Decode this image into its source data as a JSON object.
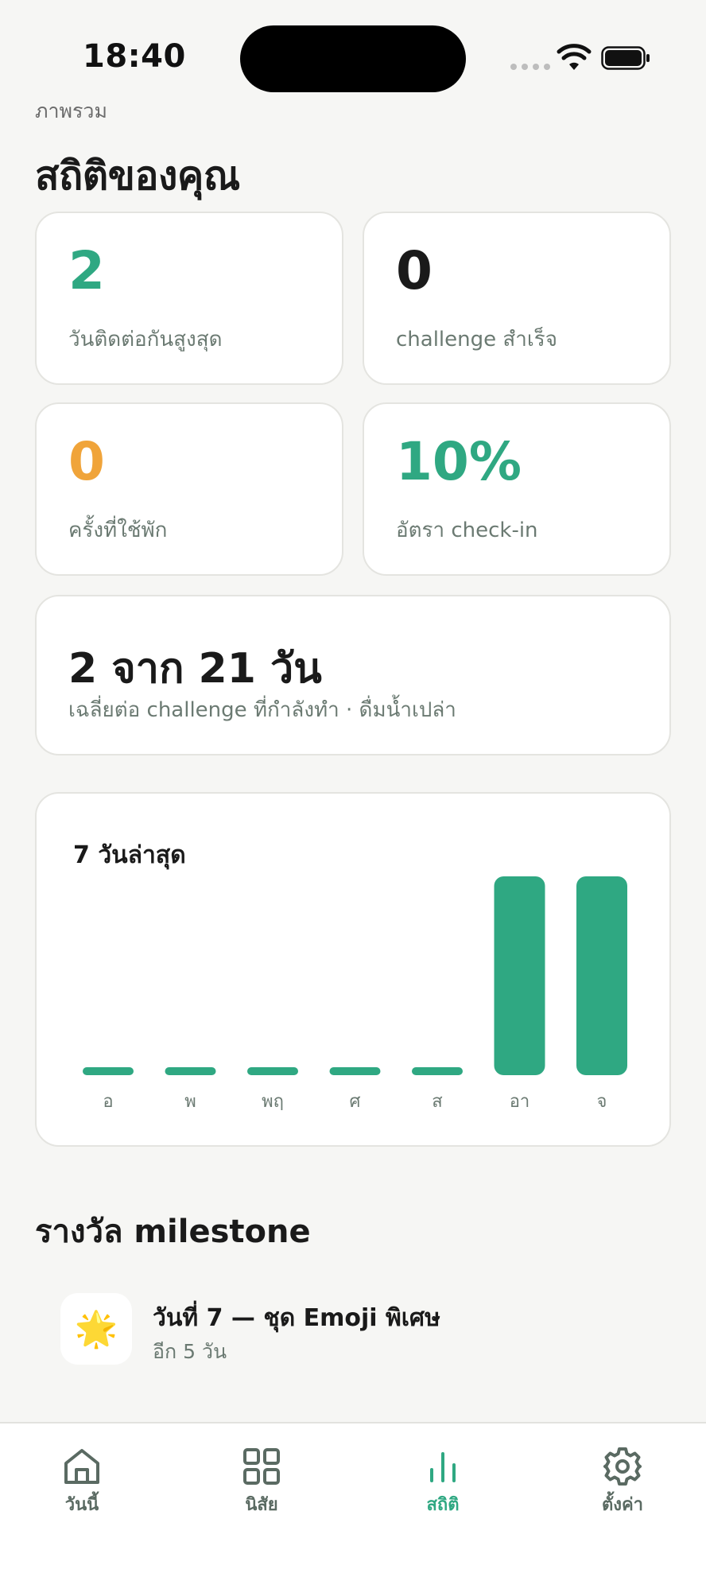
{
  "status_bar": {
    "time": "18:40"
  },
  "header": {
    "section_label": "ภาพรวม",
    "title": "สถิติของคุณ"
  },
  "colors": {
    "accent": "#2fa882",
    "orange": "#f0a43a",
    "dark": "#1a1a1a"
  },
  "stats": [
    {
      "value": "2",
      "label": "วันติดต่อกันสูงสุด",
      "color": "#2fa882"
    },
    {
      "value": "0",
      "label": "challenge สำเร็จ",
      "color": "#1a1a1a"
    },
    {
      "value": "0",
      "label": "ครั้งที่ใช้พัก",
      "color": "#f0a43a"
    },
    {
      "value": "10%",
      "label": "อัตรา check-in",
      "color": "#2fa882"
    }
  ],
  "average": {
    "value": "2 จาก 21 วัน",
    "subtitle": "เฉลี่ยต่อ challenge ที่กำลังทำ · ดื่มน้ำเปล่า"
  },
  "chart_data": {
    "type": "bar",
    "title": "7 วันล่าสุด",
    "categories": [
      "อ",
      "พ",
      "พฤ",
      "ศ",
      "ส",
      "อา",
      "จ"
    ],
    "values": [
      0,
      0,
      0,
      0,
      0,
      1,
      1
    ],
    "ylim": [
      0,
      1
    ],
    "grid": false
  },
  "milestones": {
    "title": "รางวัล milestone",
    "items": [
      {
        "icon": "star-icon",
        "emoji": "🌟",
        "name": "วันที่ 7 — ชุด Emoji พิเศษ",
        "sub": "อีก 5 วัน"
      }
    ]
  },
  "tabbar": {
    "tabs": [
      {
        "label": "วันนี้",
        "icon": "home-icon"
      },
      {
        "label": "นิสัย",
        "icon": "grid-icon"
      },
      {
        "label": "สถิติ",
        "icon": "bar-chart-icon",
        "active": true
      },
      {
        "label": "ตั้งค่า",
        "icon": "gear-icon"
      }
    ]
  }
}
